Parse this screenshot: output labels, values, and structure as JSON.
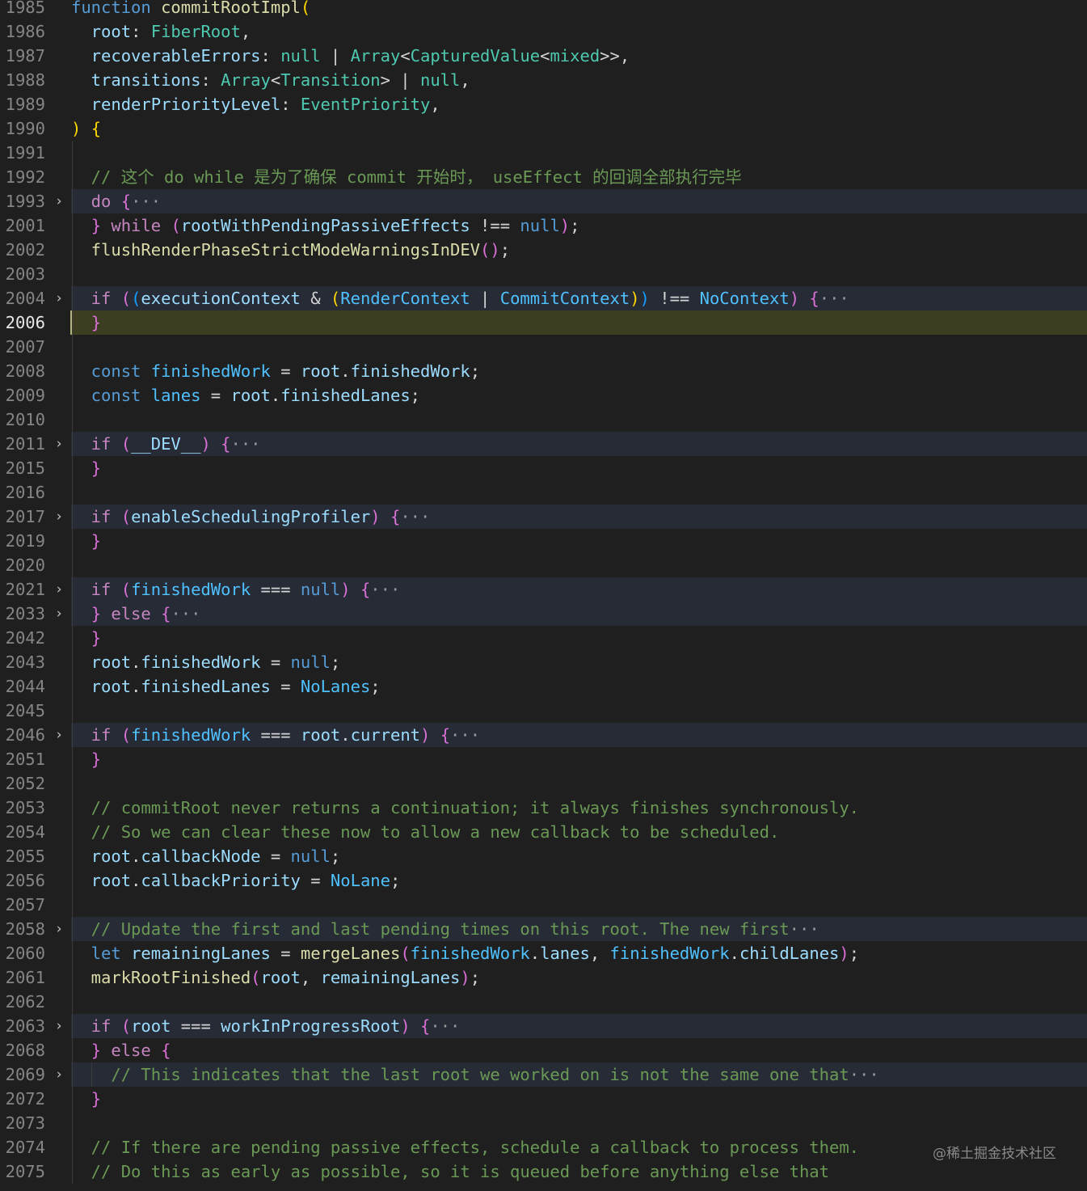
{
  "editor": {
    "lines": [
      {
        "number": "1985",
        "tokens": [
          [
            "function ",
            "kw"
          ],
          [
            "commitRootImpl",
            "fn"
          ],
          [
            "(",
            "pb1"
          ]
        ]
      },
      {
        "number": "1986",
        "tokens": [
          [
            "  root",
            "vr"
          ],
          [
            ": ",
            "pl"
          ],
          [
            "FiberRoot",
            "ty"
          ],
          [
            ",",
            "pl"
          ]
        ]
      },
      {
        "number": "1987",
        "tokens": [
          [
            "  recoverableErrors",
            "vr"
          ],
          [
            ": ",
            "pl"
          ],
          [
            "null",
            "ty"
          ],
          [
            " | ",
            "pl"
          ],
          [
            "Array",
            "ty"
          ],
          [
            "<",
            "pl"
          ],
          [
            "CapturedValue",
            "ty"
          ],
          [
            "<",
            "pl"
          ],
          [
            "mixed",
            "ty"
          ],
          [
            ">>,",
            "pl"
          ]
        ]
      },
      {
        "number": "1988",
        "tokens": [
          [
            "  transitions",
            "vr"
          ],
          [
            ": ",
            "pl"
          ],
          [
            "Array",
            "ty"
          ],
          [
            "<",
            "pl"
          ],
          [
            "Transition",
            "ty"
          ],
          [
            "> | ",
            "pl"
          ],
          [
            "null",
            "ty"
          ],
          [
            ",",
            "pl"
          ]
        ]
      },
      {
        "number": "1989",
        "tokens": [
          [
            "  renderPriorityLevel",
            "vr"
          ],
          [
            ": ",
            "pl"
          ],
          [
            "EventPriority",
            "ty"
          ],
          [
            ",",
            "pl"
          ]
        ]
      },
      {
        "number": "1990",
        "tokens": [
          [
            ")",
            "pb1"
          ],
          [
            " ",
            "pl"
          ],
          [
            "{",
            "pb1"
          ]
        ]
      },
      {
        "number": "1991",
        "tokens": []
      },
      {
        "number": "1992",
        "tokens": [
          [
            "  // 这个 do while 是为了确保 commit 开始时， useEffect 的回调全部执行完毕",
            "cm"
          ]
        ]
      },
      {
        "number": "1993",
        "fold": true,
        "tokens": [
          [
            "  do",
            "ctl"
          ],
          [
            " ",
            "pl"
          ],
          [
            "{",
            "pb2"
          ],
          [
            "···",
            "ellipsis"
          ]
        ]
      },
      {
        "number": "2001",
        "tokens": [
          [
            "  ",
            "pl"
          ],
          [
            "}",
            "pb2"
          ],
          [
            " ",
            "pl"
          ],
          [
            "while",
            "ctl"
          ],
          [
            " ",
            "pl"
          ],
          [
            "(",
            "pb2"
          ],
          [
            "rootWithPendingPassiveEffects",
            "vr"
          ],
          [
            " !== ",
            "pl"
          ],
          [
            "null",
            "kw"
          ],
          [
            ")",
            "pb2"
          ],
          [
            ";",
            "pl"
          ]
        ]
      },
      {
        "number": "2002",
        "tokens": [
          [
            "  flushRenderPhaseStrictModeWarningsInDEV",
            "fn"
          ],
          [
            "()",
            "pb2"
          ],
          [
            ";",
            "pl"
          ]
        ]
      },
      {
        "number": "2003",
        "tokens": []
      },
      {
        "number": "2004",
        "fold": true,
        "tokens": [
          [
            "  if",
            "ctl"
          ],
          [
            " ",
            "pl"
          ],
          [
            "(",
            "pb2"
          ],
          [
            "(",
            "pb3"
          ],
          [
            "executionContext",
            "vr"
          ],
          [
            " & ",
            "pl"
          ],
          [
            "(",
            "pb1"
          ],
          [
            "RenderContext",
            "cn"
          ],
          [
            " | ",
            "pl"
          ],
          [
            "CommitContext",
            "cn"
          ],
          [
            ")",
            "pb1"
          ],
          [
            ")",
            "pb3"
          ],
          [
            " !== ",
            "pl"
          ],
          [
            "NoContext",
            "cn"
          ],
          [
            ")",
            "pb2"
          ],
          [
            " ",
            "pl"
          ],
          [
            "{",
            "pb2"
          ],
          [
            "···",
            "ellipsis"
          ]
        ]
      },
      {
        "number": "2006",
        "current": true,
        "tokens": [
          [
            "  ",
            "pl"
          ],
          [
            "}",
            "pb2"
          ]
        ]
      },
      {
        "number": "2007",
        "tokens": []
      },
      {
        "number": "2008",
        "tokens": [
          [
            "  const",
            "kw"
          ],
          [
            " ",
            "pl"
          ],
          [
            "finishedWork",
            "cn"
          ],
          [
            " = ",
            "pl"
          ],
          [
            "root",
            "vr"
          ],
          [
            ".",
            "pl"
          ],
          [
            "finishedWork",
            "vr"
          ],
          [
            ";",
            "pl"
          ]
        ]
      },
      {
        "number": "2009",
        "tokens": [
          [
            "  const",
            "kw"
          ],
          [
            " ",
            "pl"
          ],
          [
            "lanes",
            "cn"
          ],
          [
            " = ",
            "pl"
          ],
          [
            "root",
            "vr"
          ],
          [
            ".",
            "pl"
          ],
          [
            "finishedLanes",
            "vr"
          ],
          [
            ";",
            "pl"
          ]
        ]
      },
      {
        "number": "2010",
        "tokens": []
      },
      {
        "number": "2011",
        "fold": true,
        "tokens": [
          [
            "  if",
            "ctl"
          ],
          [
            " ",
            "pl"
          ],
          [
            "(",
            "pb2"
          ],
          [
            "__DEV__",
            "vr"
          ],
          [
            ")",
            "pb2"
          ],
          [
            " ",
            "pl"
          ],
          [
            "{",
            "pb2"
          ],
          [
            "···",
            "ellipsis"
          ]
        ]
      },
      {
        "number": "2015",
        "tokens": [
          [
            "  ",
            "pl"
          ],
          [
            "}",
            "pb2"
          ]
        ]
      },
      {
        "number": "2016",
        "tokens": []
      },
      {
        "number": "2017",
        "fold": true,
        "tokens": [
          [
            "  if",
            "ctl"
          ],
          [
            " ",
            "pl"
          ],
          [
            "(",
            "pb2"
          ],
          [
            "enableSchedulingProfiler",
            "vr"
          ],
          [
            ")",
            "pb2"
          ],
          [
            " ",
            "pl"
          ],
          [
            "{",
            "pb2"
          ],
          [
            "···",
            "ellipsis"
          ]
        ]
      },
      {
        "number": "2019",
        "tokens": [
          [
            "  ",
            "pl"
          ],
          [
            "}",
            "pb2"
          ]
        ]
      },
      {
        "number": "2020",
        "tokens": []
      },
      {
        "number": "2021",
        "fold": true,
        "tokens": [
          [
            "  if",
            "ctl"
          ],
          [
            " ",
            "pl"
          ],
          [
            "(",
            "pb2"
          ],
          [
            "finishedWork",
            "cn"
          ],
          [
            " === ",
            "pl"
          ],
          [
            "null",
            "kw"
          ],
          [
            ")",
            "pb2"
          ],
          [
            " ",
            "pl"
          ],
          [
            "{",
            "pb2"
          ],
          [
            "···",
            "ellipsis"
          ]
        ]
      },
      {
        "number": "2033",
        "fold": true,
        "tokens": [
          [
            "  ",
            "pl"
          ],
          [
            "}",
            "pb2"
          ],
          [
            " ",
            "pl"
          ],
          [
            "else",
            "ctl"
          ],
          [
            " ",
            "pl"
          ],
          [
            "{",
            "pb2"
          ],
          [
            "···",
            "ellipsis"
          ]
        ]
      },
      {
        "number": "2042",
        "tokens": [
          [
            "  ",
            "pl"
          ],
          [
            "}",
            "pb2"
          ]
        ]
      },
      {
        "number": "2043",
        "tokens": [
          [
            "  root",
            "vr"
          ],
          [
            ".",
            "pl"
          ],
          [
            "finishedWork",
            "vr"
          ],
          [
            " = ",
            "pl"
          ],
          [
            "null",
            "kw"
          ],
          [
            ";",
            "pl"
          ]
        ]
      },
      {
        "number": "2044",
        "tokens": [
          [
            "  root",
            "vr"
          ],
          [
            ".",
            "pl"
          ],
          [
            "finishedLanes",
            "vr"
          ],
          [
            " = ",
            "pl"
          ],
          [
            "NoLanes",
            "cn"
          ],
          [
            ";",
            "pl"
          ]
        ]
      },
      {
        "number": "2045",
        "tokens": []
      },
      {
        "number": "2046",
        "fold": true,
        "tokens": [
          [
            "  if",
            "ctl"
          ],
          [
            " ",
            "pl"
          ],
          [
            "(",
            "pb2"
          ],
          [
            "finishedWork",
            "cn"
          ],
          [
            " === ",
            "pl"
          ],
          [
            "root",
            "vr"
          ],
          [
            ".",
            "pl"
          ],
          [
            "current",
            "vr"
          ],
          [
            ")",
            "pb2"
          ],
          [
            " ",
            "pl"
          ],
          [
            "{",
            "pb2"
          ],
          [
            "···",
            "ellipsis"
          ]
        ]
      },
      {
        "number": "2051",
        "tokens": [
          [
            "  ",
            "pl"
          ],
          [
            "}",
            "pb2"
          ]
        ]
      },
      {
        "number": "2052",
        "tokens": []
      },
      {
        "number": "2053",
        "tokens": [
          [
            "  // commitRoot never returns a continuation; it always finishes synchronously.",
            "cm"
          ]
        ]
      },
      {
        "number": "2054",
        "tokens": [
          [
            "  // So we can clear these now to allow a new callback to be scheduled.",
            "cm"
          ]
        ]
      },
      {
        "number": "2055",
        "tokens": [
          [
            "  root",
            "vr"
          ],
          [
            ".",
            "pl"
          ],
          [
            "callbackNode",
            "vr"
          ],
          [
            " = ",
            "pl"
          ],
          [
            "null",
            "kw"
          ],
          [
            ";",
            "pl"
          ]
        ]
      },
      {
        "number": "2056",
        "tokens": [
          [
            "  root",
            "vr"
          ],
          [
            ".",
            "pl"
          ],
          [
            "callbackPriority",
            "vr"
          ],
          [
            " = ",
            "pl"
          ],
          [
            "NoLane",
            "cn"
          ],
          [
            ";",
            "pl"
          ]
        ]
      },
      {
        "number": "2057",
        "tokens": []
      },
      {
        "number": "2058",
        "fold": true,
        "tokens": [
          [
            "  // Update the first and last pending times on this root. The new first",
            "cm"
          ],
          [
            "···",
            "ellipsis"
          ]
        ]
      },
      {
        "number": "2060",
        "tokens": [
          [
            "  let",
            "kw"
          ],
          [
            " ",
            "pl"
          ],
          [
            "remainingLanes",
            "vr"
          ],
          [
            " = ",
            "pl"
          ],
          [
            "mergeLanes",
            "fn"
          ],
          [
            "(",
            "pb2"
          ],
          [
            "finishedWork",
            "cn"
          ],
          [
            ".",
            "pl"
          ],
          [
            "lanes",
            "vr"
          ],
          [
            ", ",
            "pl"
          ],
          [
            "finishedWork",
            "cn"
          ],
          [
            ".",
            "pl"
          ],
          [
            "childLanes",
            "vr"
          ],
          [
            ")",
            "pb2"
          ],
          [
            ";",
            "pl"
          ]
        ]
      },
      {
        "number": "2061",
        "tokens": [
          [
            "  markRootFinished",
            "fn"
          ],
          [
            "(",
            "pb2"
          ],
          [
            "root",
            "vr"
          ],
          [
            ", ",
            "pl"
          ],
          [
            "remainingLanes",
            "vr"
          ],
          [
            ")",
            "pb2"
          ],
          [
            ";",
            "pl"
          ]
        ]
      },
      {
        "number": "2062",
        "tokens": []
      },
      {
        "number": "2063",
        "fold": true,
        "tokens": [
          [
            "  if",
            "ctl"
          ],
          [
            " ",
            "pl"
          ],
          [
            "(",
            "pb2"
          ],
          [
            "root",
            "vr"
          ],
          [
            " === ",
            "pl"
          ],
          [
            "workInProgressRoot",
            "vr"
          ],
          [
            ")",
            "pb2"
          ],
          [
            " ",
            "pl"
          ],
          [
            "{",
            "pb2"
          ],
          [
            "···",
            "ellipsis"
          ]
        ]
      },
      {
        "number": "2068",
        "tokens": [
          [
            "  ",
            "pl"
          ],
          [
            "}",
            "pb2"
          ],
          [
            " ",
            "pl"
          ],
          [
            "else",
            "ctl"
          ],
          [
            " ",
            "pl"
          ],
          [
            "{",
            "pb2"
          ]
        ]
      },
      {
        "number": "2069",
        "fold": true,
        "guide2": true,
        "tokens": [
          [
            "    // This indicates that the last root we worked on is not the same one that",
            "cm"
          ],
          [
            "···",
            "ellipsis"
          ]
        ]
      },
      {
        "number": "2072",
        "tokens": [
          [
            "  ",
            "pl"
          ],
          [
            "}",
            "pb2"
          ]
        ]
      },
      {
        "number": "2073",
        "tokens": []
      },
      {
        "number": "2074",
        "tokens": [
          [
            "  // If there are pending passive effects, schedule a callback to process them.",
            "cm"
          ]
        ]
      },
      {
        "number": "2075",
        "tokens": [
          [
            "  // Do this as early as possible, so it is queued before anything else that",
            "cm"
          ]
        ]
      }
    ]
  },
  "watermark": "@稀土掘金技术社区"
}
